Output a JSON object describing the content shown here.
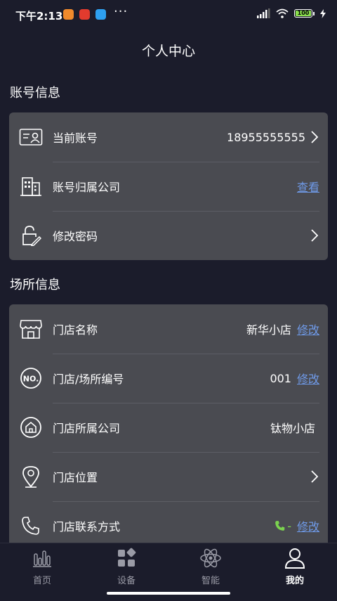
{
  "status_bar": {
    "time": "下午2:13",
    "dots": "···",
    "battery": "100"
  },
  "page_title": "个人中心",
  "account_section": {
    "title": "账号信息",
    "rows": [
      {
        "label": "当前账号",
        "value": "18955555555"
      },
      {
        "label": "账号归属公司",
        "link": "查看"
      },
      {
        "label": "修改密码"
      }
    ]
  },
  "venue_section": {
    "title": "场所信息",
    "rows": [
      {
        "label": "门店名称",
        "value": "新华小店",
        "link": "修改"
      },
      {
        "label": "门店/场所编号",
        "value": "001",
        "link": "修改"
      },
      {
        "label": "门店所属公司",
        "value": "钛物小店"
      },
      {
        "label": "门店位置"
      },
      {
        "label": "门店联系方式",
        "value": "-",
        "link": "修改"
      }
    ]
  },
  "tabs": [
    {
      "label": "首页",
      "icon": "bar-chart-icon"
    },
    {
      "label": "设备",
      "icon": "device-grid-icon"
    },
    {
      "label": "智能",
      "icon": "atom-icon"
    },
    {
      "label": "我的",
      "icon": "user-icon",
      "active": true
    }
  ],
  "colors": {
    "background": "#1b1c2b",
    "card": "#4a4b51",
    "link": "#6f9ae8",
    "phone_green": "#7bd34f"
  }
}
